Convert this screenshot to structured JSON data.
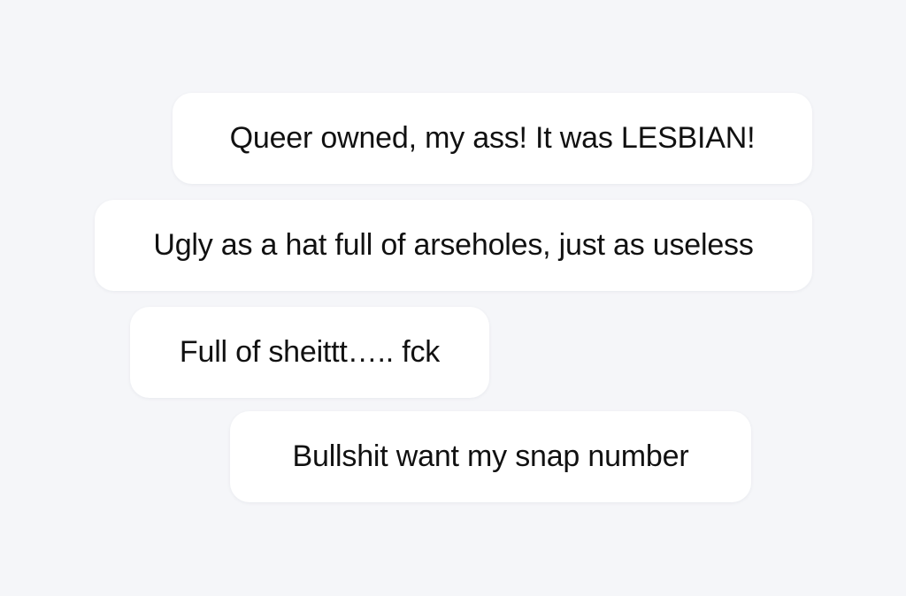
{
  "messages": [
    {
      "text": "Queer owned, my ass! It was LESBIAN!"
    },
    {
      "text": "Ugly as a hat full of arseholes, just as useless"
    },
    {
      "text": "Full of sheittt….. fck"
    },
    {
      "text": "Bullshit want my snap number"
    }
  ],
  "colors": {
    "background": "#f5f6f9",
    "bubble": "#ffffff",
    "text": "#111111"
  }
}
